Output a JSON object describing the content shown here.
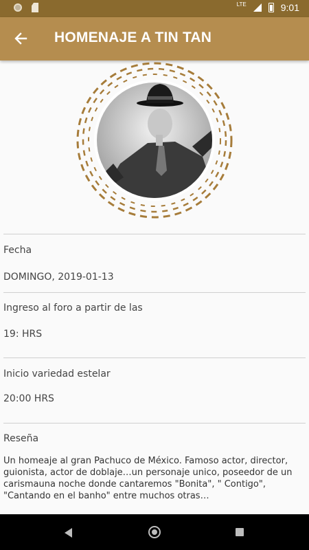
{
  "status_bar": {
    "time": "9:01",
    "network": "LTE"
  },
  "app_bar": {
    "title": "HOMENAJE A TIN TAN"
  },
  "hero": {
    "image_alt": "Tin Tan photo",
    "frame_color": "#a67c3a"
  },
  "details": [
    {
      "label": "Fecha",
      "value": "DOMINGO, 2019-01-13"
    },
    {
      "label": "Ingreso al foro a partir de las",
      "value": "19: HRS"
    },
    {
      "label": "Inicio variedad estelar",
      "value": "20:00 HRS"
    },
    {
      "label": "Reseña",
      "value": ""
    }
  ],
  "resena_text": "Un homeaje al gran Pachuco de México.   Famoso actor, director, guionista, actor de doblaje…un personaje unico, poseedor de un carismauna noche donde cantaremos \"Bonita\", \" Contigo\", \"Cantando en el banho\" entre muchos otras…",
  "colors": {
    "status": "#8a6a2e",
    "appbar": "#b58d4f",
    "background": "#fafafa"
  }
}
